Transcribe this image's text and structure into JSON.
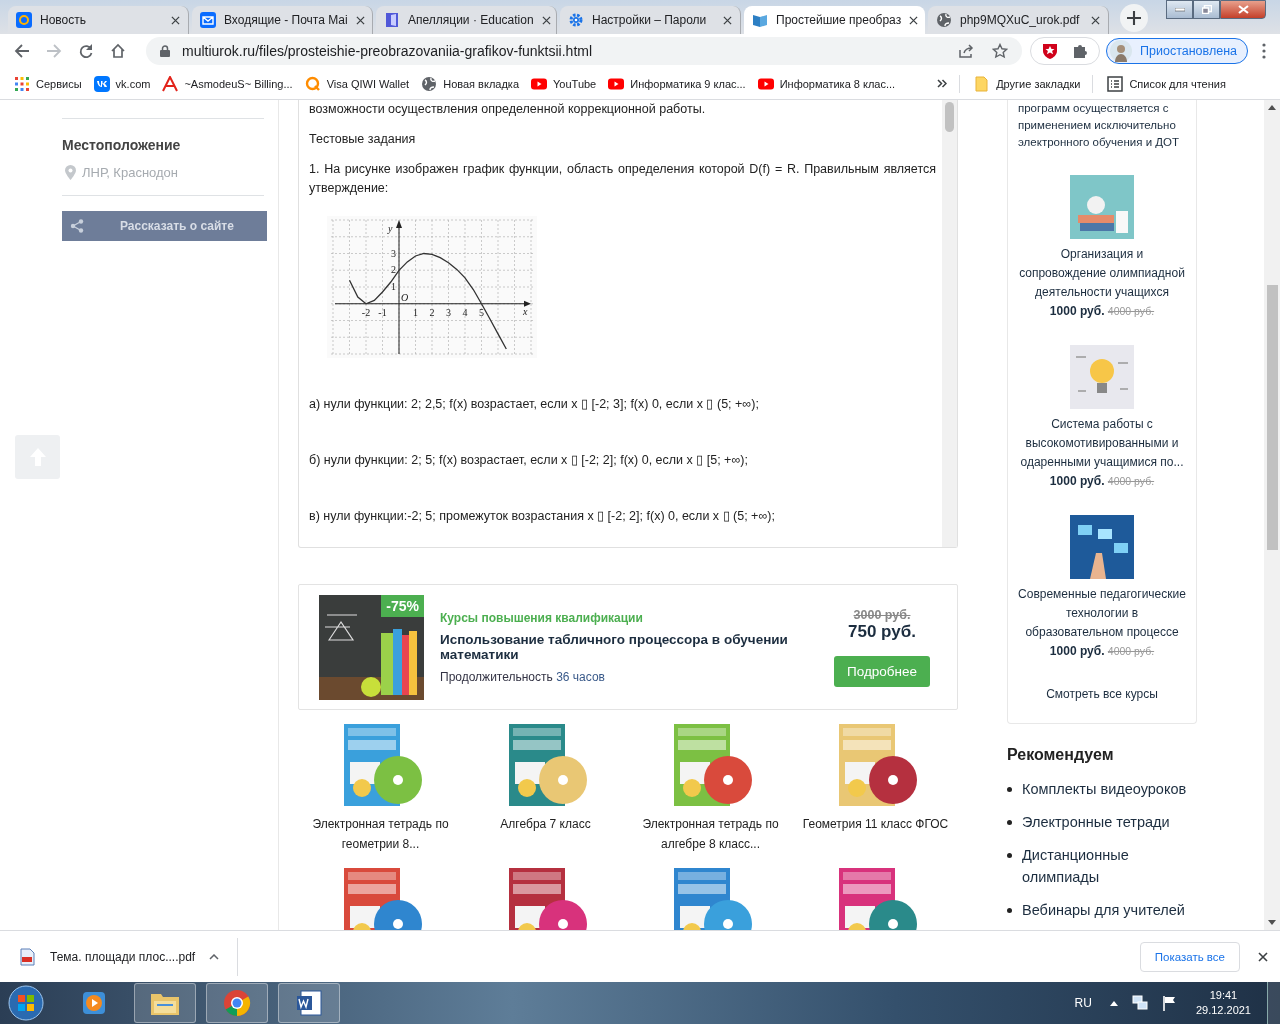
{
  "browser": {
    "tabs": [
      {
        "title": "Новость",
        "selected": false
      },
      {
        "title": "Входящие - Почта Mai",
        "selected": false
      },
      {
        "title": "Апелляции · Education",
        "selected": false
      },
      {
        "title": "Настройки – Пароли",
        "selected": false
      },
      {
        "title": "Простейшие преобраз",
        "selected": true
      },
      {
        "title": "php9MQXuC_urok.pdf",
        "selected": false
      }
    ],
    "address": "multiurok.ru/files/prosteishie-preobrazovaniia-grafikov-funktsii.html",
    "profile": "Приостановлена",
    "bookmarks": [
      "Сервисы",
      "vk.com",
      "~AsmodeuS~ Billing...",
      "Visa QIWI Wallet",
      "Новая вкладка",
      "YouTube",
      "Информатика 9 клас...",
      "Информатика 8 клас..."
    ],
    "other_bookmarks": "Другие закладки",
    "reading_list": "Список для чтения"
  },
  "sidebar": {
    "location_title": "Местоположение",
    "location": "ЛНР, Краснодон",
    "share_button": "Рассказать о сайте"
  },
  "document": {
    "paragraphs": [
      "возможности осуществления определенной коррекционной работы.",
      "Тестовые задания",
      "1. На рисунке изображен график функции, область определения которой D(f) = R. Правильным является утверждение:"
    ],
    "chart_data": {
      "type": "line",
      "xlabel": "x",
      "ylabel": "y",
      "x": [
        -3,
        -2.5,
        -2,
        -1.5,
        -1,
        -0.5,
        0,
        0.5,
        1,
        1.5,
        2,
        2.5,
        3,
        3.5,
        4,
        4.5,
        5,
        5.5,
        6,
        6.5
      ],
      "series": [
        {
          "color": "#333333",
          "values": [
            1.4,
            0.4,
            0,
            0.2,
            0.7,
            1.3,
            2,
            2.5,
            2.85,
            3,
            2.95,
            2.75,
            2.45,
            2.05,
            1.55,
            0.85,
            0,
            -0.9,
            -1.8,
            -2.7
          ]
        }
      ],
      "xlim": [
        -4,
        8
      ],
      "ylim": [
        -3,
        5
      ],
      "grid": true,
      "xticks": [
        -2,
        -1,
        1,
        2,
        3,
        4,
        5
      ],
      "yticks": [
        1,
        2,
        3
      ],
      "annotations": [
        "O"
      ]
    },
    "options": [
      "а) нули функции: 2; 2,5; f(x) возрастает, если x ▯ [-2; 3]; f(x) 0, если x ▯ (5; +∞);",
      "б) нули функции: 2; 5; f(x) возрастает, если x ▯ [-2; 2]; f(x) 0, если x ▯ [5; +∞);",
      "в) нули функции:-2; 5; промежуток возрастания x ▯ [-2; 2]; f(x) 0, если x ▯ (5; +∞);"
    ]
  },
  "course_ad": {
    "badge": "-75%",
    "category": "Курсы повышения квалификации",
    "title": "Использование табличного процессора в обучении математики",
    "duration_label": "Продолжительность",
    "duration": "36 часов",
    "old_price": "3000 руб.",
    "price": "750 руб.",
    "button": "Подробнее"
  },
  "products": [
    {
      "kind": "picture",
      "title": "Электронная тетрадь по геометрии 8..."
    },
    {
      "kind": "picture",
      "title": "Алгебра 7 класс"
    },
    {
      "kind": "picture",
      "title": "Электронная тетрадь по алгебре 8 класс..."
    },
    {
      "kind": "picture",
      "title": "Геометрия 11 класс ФГОС"
    },
    {
      "kind": "picture"
    },
    {
      "kind": "picture"
    },
    {
      "kind": "picture"
    },
    {
      "kind": "picture"
    }
  ],
  "courses_panel": {
    "intro": "программ осуществляется с применением исключительно электронного обучения и ДОТ",
    "courses": [
      {
        "title": "Организация и сопровождение олимпиадной деятельности учащихся",
        "price": "1000 руб.",
        "old_price": "4000 руб."
      },
      {
        "title": "Система работы с высокомотивированными и одаренными учащимися по...",
        "price": "1000 руб.",
        "old_price": "4000 руб."
      },
      {
        "title": "Современные педагогические технологии в образовательном процессе",
        "price": "1000 руб.",
        "old_price": "4000 руб."
      }
    ],
    "all_courses": "Смотреть все курсы"
  },
  "recommend": {
    "title": "Рекомендуем",
    "items": [
      "Комплекты видеоуроков",
      "Электронные тетради",
      "Дистанционные олимпиады",
      "Вебинары для учителей"
    ]
  },
  "downloads": {
    "file": "Тема. площади плос....pdf",
    "show_all": "Показать все"
  },
  "taskbar": {
    "language": "RU",
    "time": "19:41",
    "date": "29.12.2021"
  }
}
